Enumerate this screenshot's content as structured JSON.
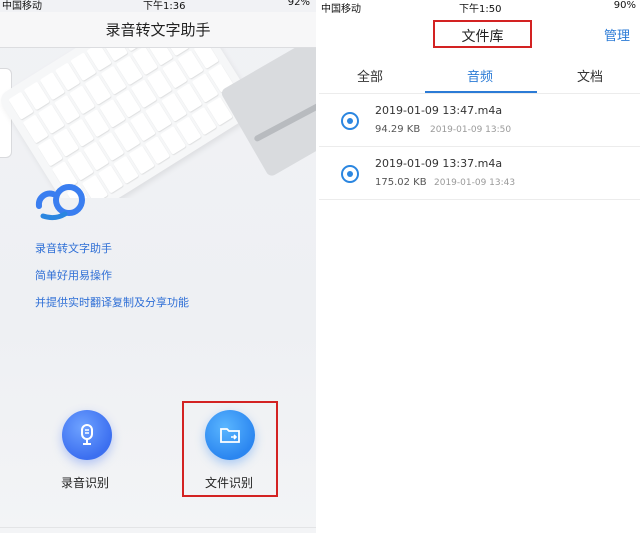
{
  "left": {
    "status": {
      "carrier": "中国移动",
      "time": "下午1:36",
      "battery": "92%"
    },
    "title": "录音转文字助手",
    "features": [
      "录音转文字助手",
      "简单好用易操作",
      "并提供实时翻译复制及分享功能"
    ],
    "buttons": {
      "record_label": "录音识别",
      "file_label": "文件识别"
    }
  },
  "right": {
    "status": {
      "carrier": "中国移动",
      "time": "下午1:50",
      "battery": "90%"
    },
    "title": "文件库",
    "manage": "管理",
    "tabs": [
      "全部",
      "音频",
      "文档"
    ],
    "active_tab": "音频",
    "files": [
      {
        "name": "2019-01-09 13:47.m4a",
        "size": "94.29 KB",
        "time": "2019-01-09 13:50"
      },
      {
        "name": "2019-01-09 13:37.m4a",
        "size": "175.02 KB",
        "time": "2019-01-09 13:43"
      }
    ]
  },
  "colors": {
    "accent": "#2b7bd6",
    "highlight_box": "#d32222"
  }
}
